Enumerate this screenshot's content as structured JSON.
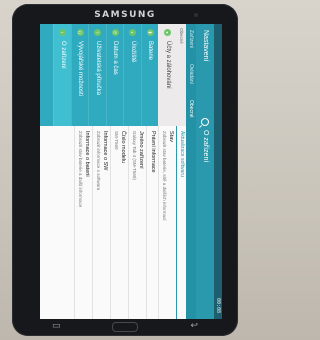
{
  "device": {
    "brand": "SAMSUNG"
  },
  "status": {
    "time": "00:08"
  },
  "app": {
    "title": "Nastavení",
    "pane_title": "O zařízení"
  },
  "tabs": [
    "Zařízení",
    "Ovládání",
    "Obecné"
  ],
  "sidebar": {
    "header": "Obecné",
    "items": [
      {
        "label": "Účty a zálohování",
        "icon": "accounts-icon"
      },
      {
        "label": "Baterie",
        "icon": "battery-icon"
      },
      {
        "label": "Úložiště",
        "icon": "storage-icon"
      },
      {
        "label": "Datum a čas",
        "icon": "clock-icon"
      },
      {
        "label": "Uživatelská příručka",
        "icon": "manual-icon"
      },
      {
        "label": "Vývojářské možnosti",
        "icon": "developer-icon"
      },
      {
        "label": "O zařízení",
        "icon": "info-icon"
      }
    ]
  },
  "content": {
    "section": "Aktualizace softwaru",
    "rows": [
      {
        "title": "Stav",
        "sub": "Zobrazit stav baterie, sítě a dalších informací"
      },
      {
        "title": "Právní informace",
        "sub": ""
      },
      {
        "title": "Jméno zařízení",
        "sub": "Galaxy Tab 4 (SM-T560)"
      },
      {
        "title": "Číslo modelu",
        "sub": "SM-T560"
      },
      {
        "title": "Informace o SW",
        "sub": "Zobrazit informace o softwaru"
      },
      {
        "title": "Informace o baterii",
        "sub": "Zobrazit stav baterie a další informace"
      }
    ]
  }
}
